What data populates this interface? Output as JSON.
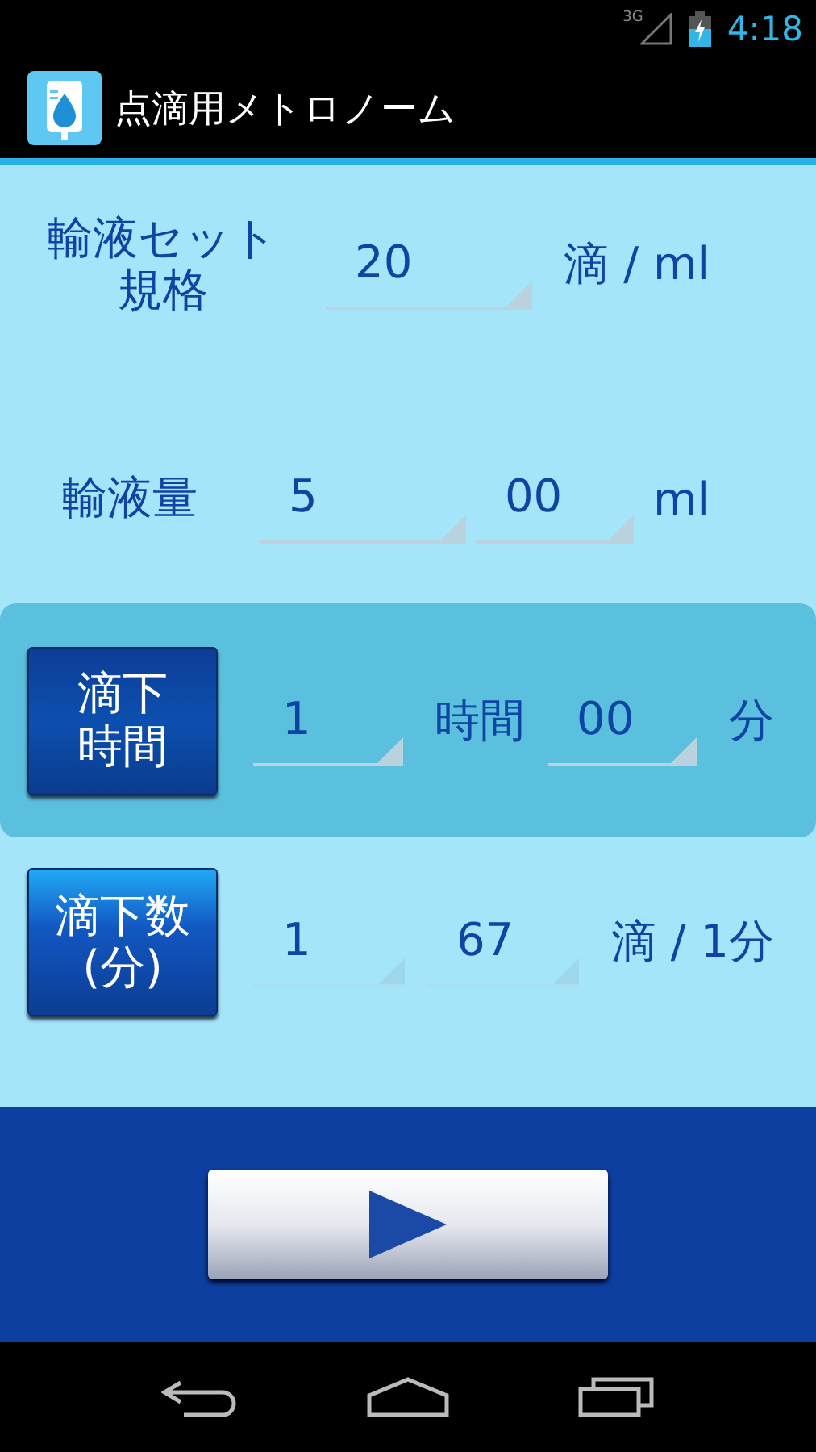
{
  "status_bar": {
    "network": "3G",
    "time": "4:18"
  },
  "app_bar": {
    "title": "点滴用メトロノーム"
  },
  "rows": [
    {
      "kind": "label",
      "label": [
        "輸液セット",
        "規格"
      ],
      "items": [
        {
          "kind": "field",
          "value": "20",
          "disabled": false
        },
        {
          "kind": "unit",
          "text": "滴 / ml"
        }
      ]
    },
    {
      "kind": "label",
      "label": [
        "輸液量"
      ],
      "items": [
        {
          "kind": "field",
          "value": "5",
          "disabled": false
        },
        {
          "kind": "field",
          "value": "00",
          "disabled": false
        },
        {
          "kind": "unit",
          "text": "ml"
        }
      ]
    },
    {
      "kind": "mode",
      "label": [
        "滴下",
        "時間"
      ],
      "selected": true,
      "items": [
        {
          "kind": "field",
          "value": "1",
          "disabled": false
        },
        {
          "kind": "unit",
          "text": "時間"
        },
        {
          "kind": "field",
          "value": "00",
          "disabled": false
        },
        {
          "kind": "unit",
          "text": "分"
        }
      ]
    },
    {
      "kind": "mode",
      "label": [
        "滴下数",
        "(分)"
      ],
      "selected": false,
      "items": [
        {
          "kind": "field",
          "value": "1",
          "disabled": true
        },
        {
          "kind": "field",
          "value": "67",
          "disabled": true
        },
        {
          "kind": "unit",
          "text": "滴 / 1分"
        }
      ]
    }
  ]
}
